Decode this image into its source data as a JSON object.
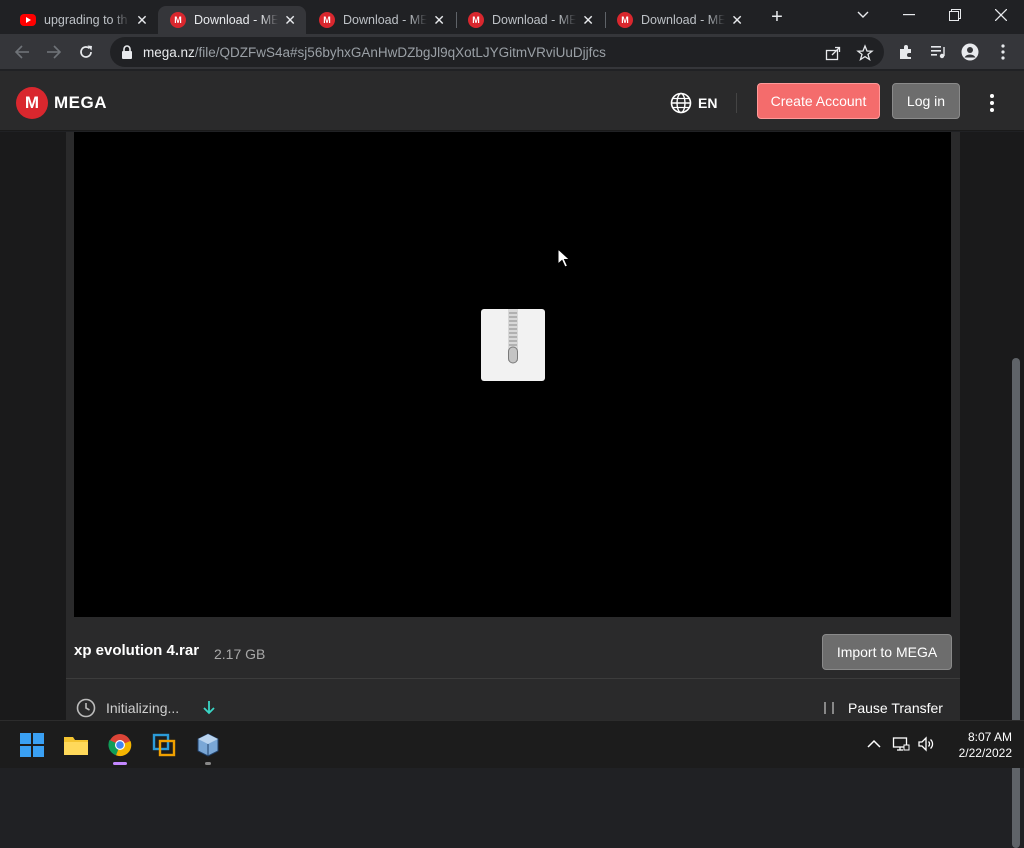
{
  "browser": {
    "tabs": [
      {
        "label": "upgrading to th",
        "icon": "youtube-icon",
        "active": false
      },
      {
        "label": "Download - ME",
        "icon": "mega-icon",
        "active": true
      },
      {
        "label": "Download - ME",
        "icon": "mega-icon",
        "active": false
      },
      {
        "label": "Download - ME",
        "icon": "mega-icon",
        "active": false
      },
      {
        "label": "Download - ME",
        "icon": "mega-icon",
        "active": false
      }
    ],
    "address": {
      "host": "mega.nz",
      "path": "/file/QDZFwS4a#sj56byhxGAnHwDZbgJl9qXotLJYGitmVRviUuDjjfcs"
    }
  },
  "mega": {
    "logo_letter": "M",
    "brand": "MEGA",
    "language": "EN",
    "create_account": "Create Account",
    "login": "Log in"
  },
  "file": {
    "name": "xp evolution 4.rar",
    "size": "2.17 GB",
    "import_label": "Import to MEGA",
    "status": "Initializing...",
    "pause_label": "Pause Transfer"
  },
  "taskbar": {
    "apps": [
      "windows-start",
      "file-explorer",
      "chrome",
      "vmware",
      "virtualbox"
    ],
    "time": "8:07 AM",
    "date": "2/22/2022"
  },
  "colors": {
    "mega_red": "#d9272e",
    "create_button": "#f46c6c",
    "background": "#2a2a2b"
  }
}
